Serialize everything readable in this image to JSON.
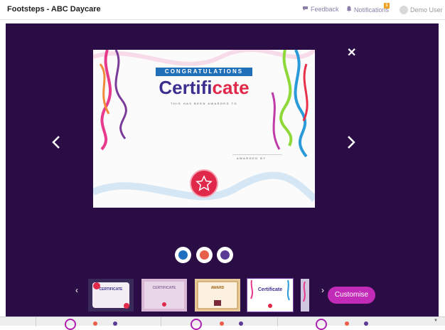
{
  "header": {
    "app_title": "Footsteps - ABC Daycare",
    "feedback_label": "Feedback",
    "notifications_label": "Notifications",
    "notifications_count": "1",
    "user_label": "Demo User"
  },
  "certificate": {
    "banner": "CONGRATULATIONS",
    "title_part1": "Certifi",
    "title_part2": "cate",
    "subtitle": "THIS HAS BEEN AWARDED TO",
    "awarded_by": "AWARDED BY"
  },
  "colors": {
    "options": [
      "#1f6fc0",
      "#e8604a",
      "#5a3a94"
    ],
    "brand_purple": "#2b0d45",
    "accent": "#c12bb8"
  },
  "thumbnails": {
    "items": [
      {
        "label": "CERTIFICATE"
      },
      {
        "label": "CERTIFICATE"
      },
      {
        "label": "AWARD"
      },
      {
        "label": "Certificate"
      }
    ]
  },
  "actions": {
    "customise_label": "Customise"
  }
}
